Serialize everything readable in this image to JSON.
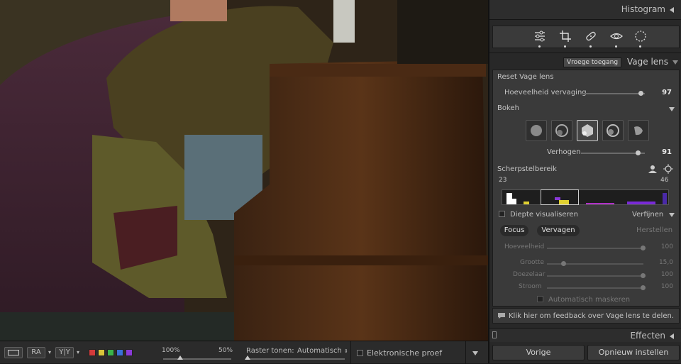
{
  "panel": {
    "histogram_title": "Histogram",
    "early_access_label": "Vroege toegang",
    "section_title": "Vage lens",
    "reset_label": "Reset Vage lens",
    "blur_amount": {
      "label": "Hoeveelheid vervaging",
      "value": "97"
    },
    "bokeh_label": "Bokeh",
    "boost": {
      "label": "Verhogen",
      "value": "91"
    },
    "focus_range": {
      "label": "Scherpstelbereik",
      "min": "23",
      "max": "46"
    },
    "depth_visualize_label": "Diepte visualiseren",
    "refine_label": "Verfijnen",
    "focus_tab": "Focus",
    "blur_tab": "Vervagen",
    "restore_label": "Herstellen",
    "sliders": [
      {
        "label": "Hoeveelheid",
        "value": "100"
      },
      {
        "label": "Grootte",
        "value": "15,0"
      },
      {
        "label": "Doezelaar",
        "value": "100"
      },
      {
        "label": "Stroom",
        "value": "100"
      }
    ],
    "auto_mask_label": "Automatisch maskeren",
    "feedback_label": "Klik hier om feedback over Vage lens te delen.",
    "effects_title": "Effecten",
    "prev_button": "Vorige",
    "reset_button": "Opnieuw instellen"
  },
  "toolbar": {
    "view_ra": "RA",
    "view_yy": "Y|Y",
    "zoom_min": "100%",
    "zoom_max": "50%",
    "raster_label": "Raster tonen:",
    "raster_value": "Automatisch",
    "soft_proof_label": "Elektronische proef",
    "swatch_colors": [
      "#d33a3a",
      "#d8c53a",
      "#3ab34a",
      "#3a70d8",
      "#8a3ad8"
    ]
  },
  "colors": {
    "accent": "#cfcfcf",
    "panel_bg": "#282828"
  }
}
